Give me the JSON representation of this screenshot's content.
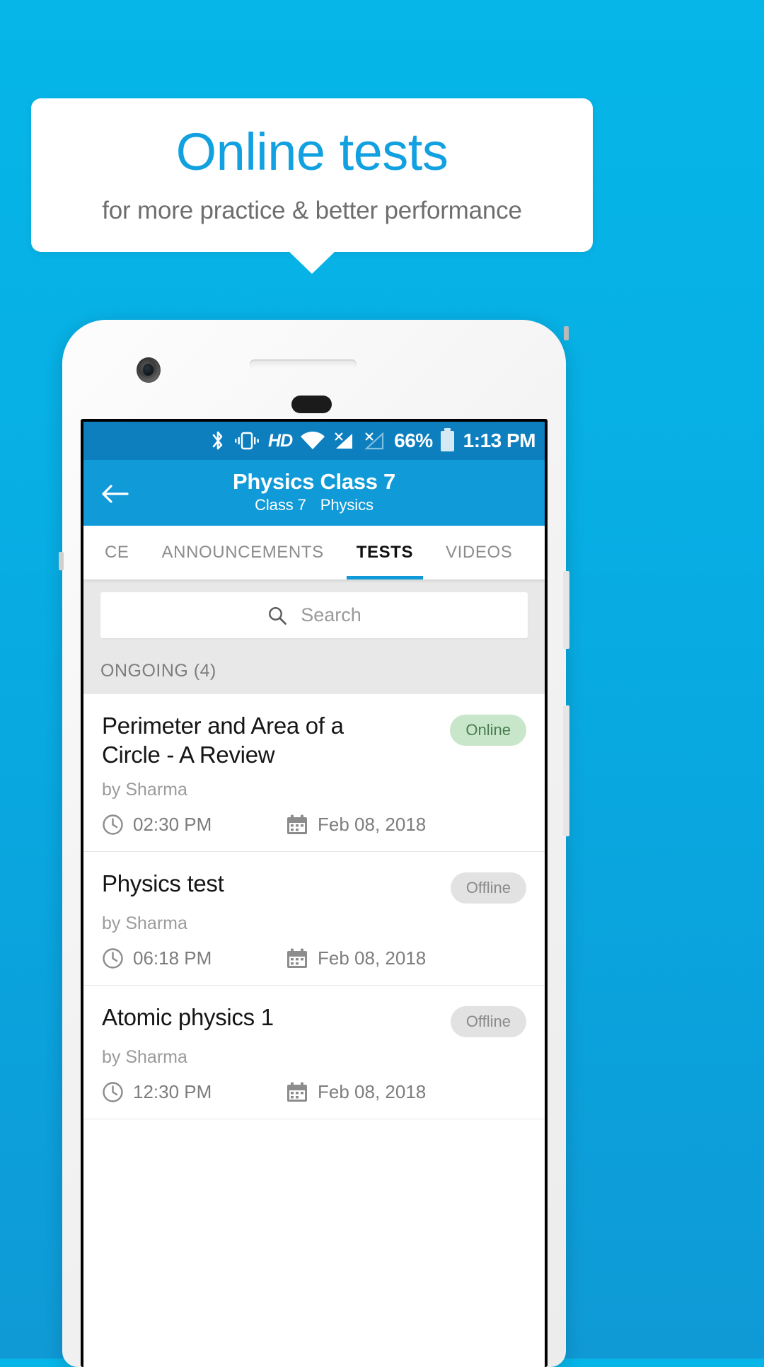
{
  "promo": {
    "title": "Online tests",
    "subtitle": "for more practice & better performance",
    "title_color": "#12a1e0",
    "subtitle_color": "#6e6e6e",
    "background_color": "#07aee4"
  },
  "status_bar": {
    "icons": [
      "bluetooth-icon",
      "vibrate-icon",
      "hd-icon",
      "wifi-icon",
      "signal-no-sim-1-icon",
      "signal-no-sim-2-icon"
    ],
    "hd_label": "HD",
    "battery_percent": "66%",
    "time": "1:13 PM",
    "background_color": "#0d7fbf"
  },
  "appbar": {
    "back_icon": "back-arrow-icon",
    "title": "Physics Class 7",
    "subtitle_class": "Class 7",
    "subtitle_subject": "Physics",
    "background_color": "#109ad8"
  },
  "tabs": {
    "items": [
      {
        "label": "CE",
        "active": false
      },
      {
        "label": "ANNOUNCEMENTS",
        "active": false
      },
      {
        "label": "TESTS",
        "active": true
      },
      {
        "label": "VIDEOS",
        "active": false
      }
    ],
    "indicator_color": "#109ad8"
  },
  "search": {
    "placeholder": "Search",
    "icon": "search-icon"
  },
  "section": {
    "label": "ONGOING (4)"
  },
  "tests": [
    {
      "title": "Perimeter and Area of a Circle - A Review",
      "author": "by Sharma",
      "status": "Online",
      "status_type": "online",
      "time": "02:30 PM",
      "date": "Feb 08, 2018"
    },
    {
      "title": "Physics test",
      "author": "by Sharma",
      "status": "Offline",
      "status_type": "offline",
      "time": "06:18 PM",
      "date": "Feb 08, 2018"
    },
    {
      "title": "Atomic physics 1",
      "author": "by Sharma",
      "status": "Offline",
      "status_type": "offline",
      "time": "12:30 PM",
      "date": "Feb 08, 2018"
    }
  ],
  "colors": {
    "badge_online_bg": "#c8e6c9",
    "badge_online_text": "#4a7c4e",
    "badge_offline_bg": "#e2e2e2",
    "badge_offline_text": "#8a8a8a"
  }
}
